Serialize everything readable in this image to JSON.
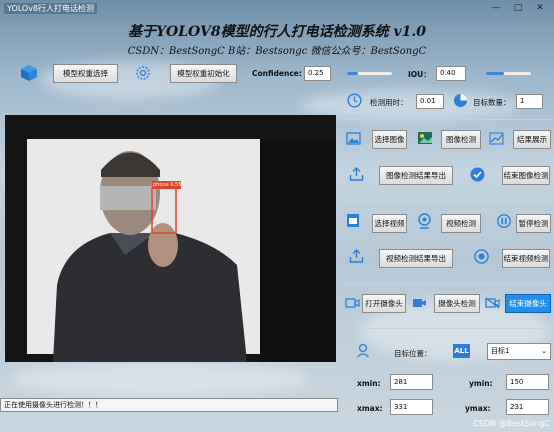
{
  "window": {
    "title": "YOLOv8行人打电话检测"
  },
  "header": {
    "title": "基于YOLOV8模型的行人打电话检测系统 v1.0",
    "subtitle": "CSDN：BestSongC   B站：Bestsongc   微信公众号：BestSongC"
  },
  "toolbar": {
    "select_model": "模型权重选择",
    "init_model": "模型权重初始化",
    "conf_label": "Confidence:",
    "conf_value": "0.25",
    "conf_level": 0.25,
    "iou_label": "IOU：",
    "iou_value": "0.40",
    "iou_level": 0.4
  },
  "stats": {
    "time_label": "检测用时：",
    "time_value": "0.01",
    "count_label": "目标数量：",
    "count_value": "1"
  },
  "image_section": {
    "select_image": "选择图像",
    "detect_image": "图像检测",
    "show_result": "结果展示",
    "export_image": "图像检测结果导出",
    "stop_image": "结束图像检测"
  },
  "video_section": {
    "select_video": "选择视频",
    "detect_video": "视频检测",
    "pause_detect": "暂停检测",
    "export_video": "视频检测结果导出",
    "stop_video": "结束视频检测"
  },
  "camera_section": {
    "open_camera": "打开摄像头",
    "camera_detect": "摄像头检测",
    "close_camera": "结束摄像头"
  },
  "target": {
    "position_label": "目标位置：",
    "all_badge": "ALL",
    "select_value": "目标1",
    "xmin_label": "xmin:",
    "xmin": "281",
    "ymin_label": "ymin:",
    "ymin": "150",
    "xmax_label": "xmax:",
    "xmax": "331",
    "ymax_label": "ymax:",
    "ymax": "231"
  },
  "detection": {
    "label": "phone 0.55"
  },
  "status": {
    "message": "正在使用摄像头进行检测！！！"
  },
  "watermark": "CSDN @BestSongC",
  "colors": {
    "accent": "#1f8ff0",
    "box": "#e0452b",
    "bg_sky": "#9fb8cc"
  }
}
